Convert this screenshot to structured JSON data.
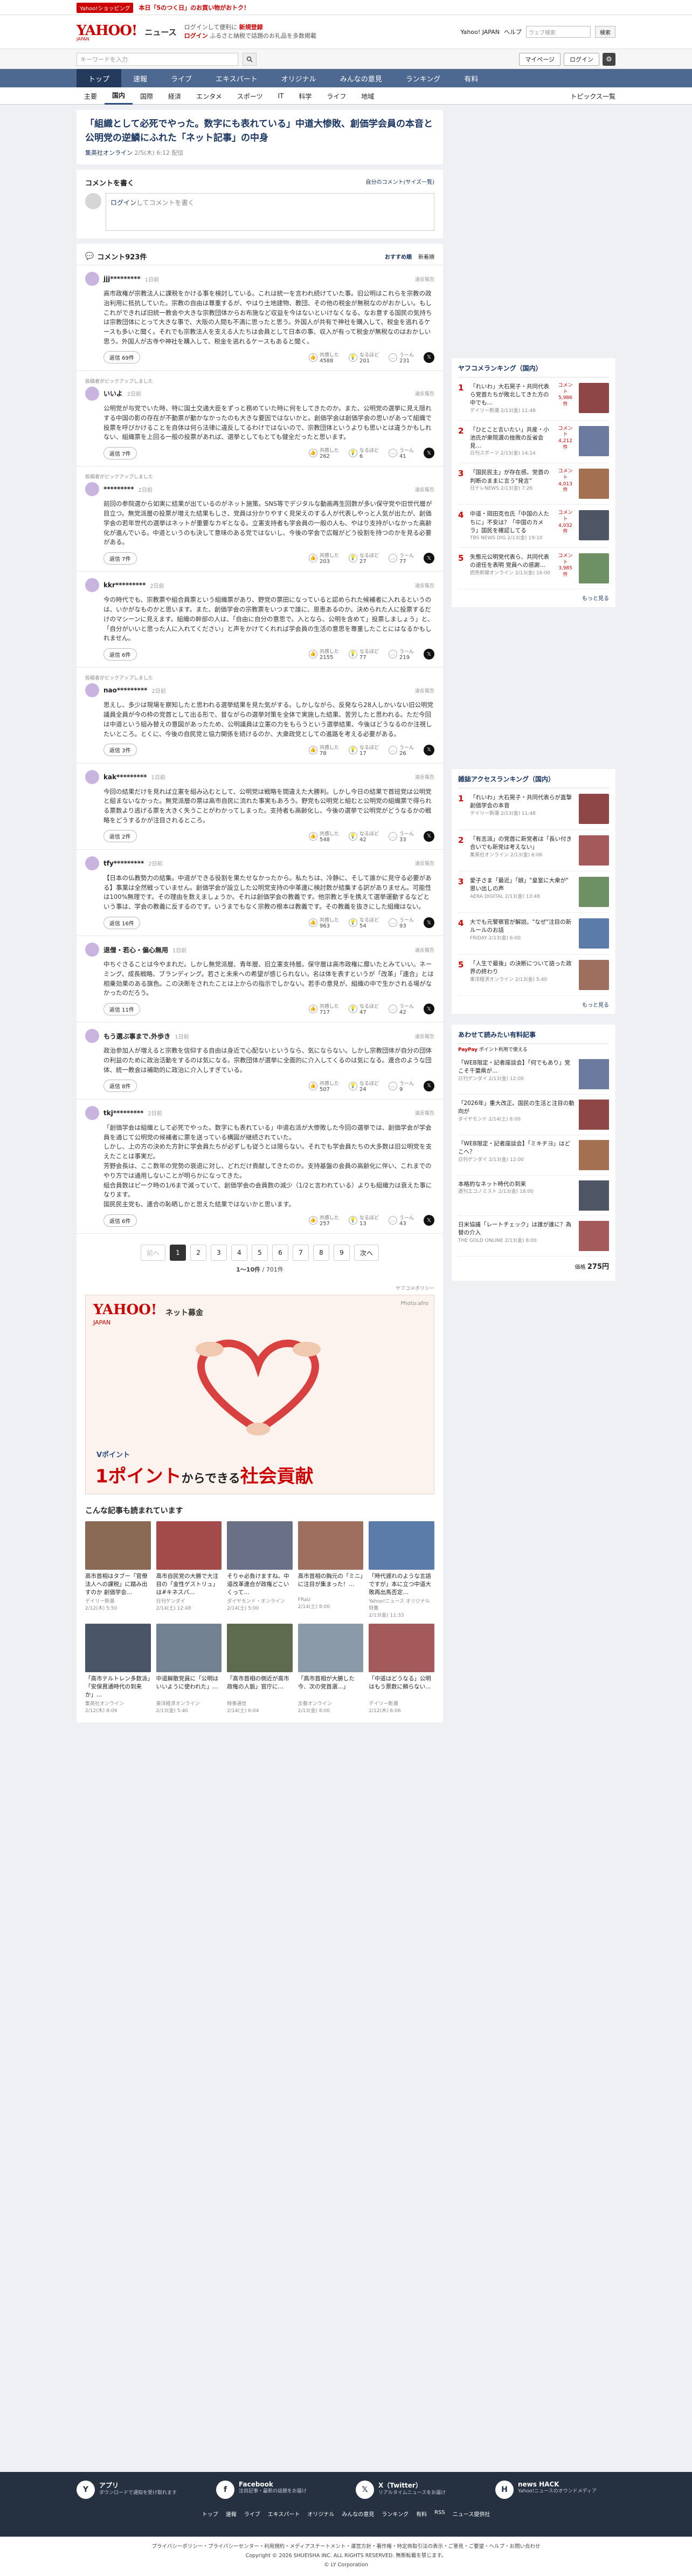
{
  "topline": {
    "promo": "Yahoo!ショッピング",
    "promo_text": "本日「5のつく日」のお買い物がおトク！"
  },
  "header": {
    "logo": "YAHOO!",
    "logo_sub": "JAPAN",
    "service": "ニュース",
    "l1a": "ログインして便利に",
    "l1b": "新規登録",
    "l2a": "ログイン",
    "l2b": "ふるさと納税で話題のお礼品を多数掲載",
    "yj": "Yahoo! JAPAN",
    "help": "ヘルプ",
    "search_ph": "ウェブ検索",
    "search_btn": "検索"
  },
  "searchbar": {
    "placeholder": "キーワードを入力",
    "mypage": "マイページ",
    "login": "ログイン",
    "gear": "⚙"
  },
  "gnav": [
    "トップ",
    "速報",
    "ライブ",
    "エキスパート",
    "オリジナル",
    "みんなの意見",
    "ランキング",
    "有料"
  ],
  "snav": [
    "主要",
    "国内",
    "国際",
    "経済",
    "エンタメ",
    "スポーツ",
    "IT",
    "科学",
    "ライフ",
    "地域"
  ],
  "snav_right": "トピックス一覧",
  "article": {
    "title": "「組織として必死でやった。数字にも表れている」中道大惨敗、創価学会員の本音と公明党の逆鱗にふれた「ネット記事」の中身",
    "source": "集英社オンライン",
    "date": "2/5(木) 6:12 配信"
  },
  "comment_box": {
    "title": "コメントを書く",
    "rule": "自分のコメント(サイズ一覧)",
    "login": "ログイン",
    "text": "してコメントを書く"
  },
  "clist": {
    "title": "コメント923件",
    "sort1": "おすすめ順",
    "sort2": "新着順"
  },
  "labels": {
    "reply": "返信",
    "agree": "共感した",
    "insight": "なるほど",
    "hmm": "うーん",
    "report": "違反報告",
    "x": "𝕏",
    "pick": "投稿者がピックアップしました"
  },
  "comments": [
    {
      "name": "jjj*********",
      "time": "1日前",
      "pick": "",
      "body": "高市政権が宗教法人に課税をかける事を検討している。これは統一を言われ続けていた事。旧公明はこれらを宗教の政治利用に抵抗していた。宗教の自由は尊重するが、やはり土地建物、教団、その他の税金が無税なのがおかしい。もしこれができれば旧統一教会や大きな宗教団体からお布施など収益を今はないといけなくなる。なお意する国民の気持ちは宗教団体にとって大きな事で、大阪の人間も不満に思ったと思う。外国人が共有で神社を購入して、税金を逃れるケースも多いと聞く。それでも宗教法人を支える人たちは会員として日本の事、収入が有って税金が無税なのはおかしい思う。外国人が古寺や神社を購入して、税金を逃れるケースもあると聞く。",
      "reply": "返信 69件",
      "agree": "4588",
      "insight": "201",
      "hmm": "231"
    },
    {
      "name": "いいよ",
      "time": "2日前",
      "pick": "投稿者がピックアップしました",
      "body": "公明党が与党でいた時、特に国土交通大臣をずっと務めていた時に何をしてきたのか。また、公明党の選挙に見え隠れする中国の影の存在が不動票が動かなかったのも大きな要因ではないかと。創価学会は創価学会の思いがあって組織で投票を呼びかけることを自体は何ら法律に違反してるわけではないので、宗教団体というよりも思いとは違うかもしれない、組織票を上回る一般の投票があれば、選挙としてもとても健全だったと思います。",
      "reply": "返信 7件",
      "agree": "262",
      "insight": "6",
      "hmm": "41"
    },
    {
      "name": "*********",
      "time": "2日前",
      "pick": "投稿者がピックアップしました",
      "body": "前回の参院選から如実に結果が出ているのがネット施策。SNS等でデジタルな動画再生回数が多い保守党や旧世代層が目立つ。無党派層の投票が増えた結果もしさ、党員は分かりやすく見栄えのする人が代表しやっと人気が出たが、創価学会の若年世代の選挙はネットが重要なカギとなる。立憲支持者も学会員の一般の人も、やはり支持がいなかった高齢化が進んでいる。中道というのも決して意味のある党ではないし、今後の学会で広報がどう役割を持つのかを見る必要がある。",
      "reply": "返信 7件",
      "agree": "203",
      "insight": "27",
      "hmm": "77"
    },
    {
      "name": "kkr*********",
      "time": "2日前",
      "pick": "",
      "body": "今の時代でも、宗教票や組合員票という組織票があり、野党の票田になっていると認められた候補者に入れるというのは、いかがなものかと思います。また、創価学会の宗教票をいつまで誰に、恩恵あるのか。決められた人に投票するだけのマシーンに見えます。組織の幹部の人は、「自由に自分の意思で。入となら、公明を含めて」投票しましょう」と、「自分がいいと思った人に入れてください」と声をかけてくれれば学会員の生活の意思を尊重したことにはなるかもしれません。",
      "reply": "返信 6件",
      "agree": "2155",
      "insight": "77",
      "hmm": "219"
    },
    {
      "name": "nao*********",
      "time": "2日前",
      "pick": "投稿者がピックアップしました",
      "body": "思えし、多少は現場を察知したと思われる選挙結果を見た気がする。しかしながら、反発なら28人しかいない旧公明党議員全員が今の枠の党首として出る形で、昔ながらの選挙対策を全体で実施した結果、苦労したと思われる。ただ今回は中道という組み替えの意図があったため、公明議員は立憲の力をもらうという選挙結果、今後はどうなるのか注視したいところ。とくに、今後の自民党と協力関係を続けるのか、大衆政党としての進路を考える必要がある。",
      "reply": "返信 3件",
      "agree": "78",
      "insight": "17",
      "hmm": "26"
    },
    {
      "name": "kak*********",
      "time": "1日前",
      "pick": "",
      "body": "今回の結果だけを見れば立憲を組み込むとして、公明党は戦略を間違えた大勝利。しかし今日の結果で首班党は公明党と組まないなかった。無党派層の票は高市自民に流れた事実もあろう。野党も公明党と組むと公明党の組織票で得られる票数より逃げる票を大きく失うことがわかってしまった。支持者も高齢化し、今後の選挙で公明党がどうなるかの戦略をどうするかが注目されるところ。",
      "reply": "返信 2件",
      "agree": "548",
      "insight": "42",
      "hmm": "33"
    },
    {
      "name": "tfy*********",
      "time": "2日前",
      "pick": "",
      "body": "【日本の仏教勢力の結集。中道ができる役割を果たせなかったから。私たちは、冷静に、そして誰かに見守る必要がある】事業は全然戦っていません。創価学会が設立した公明党支持の中革連に検討数が結集する訳がありません。可能性は100%無理です。その理由を数えましょうか。それは創価学会の教義です。他宗教と手を携えて選挙運動するなどという事は、学会の教義に反するのです。いうまでもなく宗教の根本は教義です。その教義を抜きにした組織はない。",
      "reply": "返信 16件",
      "agree": "963",
      "insight": "54",
      "hmm": "93"
    },
    {
      "name": "退僧・若心・偏心無用",
      "time": "1日前",
      "pick": "",
      "body": "中ちぐさることは今やまれだ。しかし無党派層、青年層、旧立憲支持層。保守層は高市政権に靡いたとみていい。ネーミング、成長戦略、ブランディング。若さと未来への希望が感じられない。名は体を表すというが「改革」「連合」とは相乗効果のある旗色。この決断をされたことは上からの指示でしかない。若手の意見が、組織の中で生かされる場がなかったのだろう。",
      "reply": "返信 11件",
      "agree": "717",
      "insight": "47",
      "hmm": "42"
    },
    {
      "name": "もう選ぶ事まで.外歩き",
      "time": "1日前",
      "pick": "",
      "body": "政治参加人が増えると宗教を信仰する自由は身近で心配ないというなら、気にならない。しかし宗教団体が自分の団体の利益のために政治活動をするのは気になる。宗教団体が選挙に全面的に介入してくるのは気になる。連合のような団体、統一教会は補助的に政治に介入しすぎている。",
      "reply": "返信 8件",
      "agree": "507",
      "insight": "24",
      "hmm": "9"
    },
    {
      "name": "tkj*********",
      "time": "2日前",
      "pick": "",
      "body": "「創価学会は組織として必死でやった。数字にも表れている」中道右派が大惨敗した今回の選挙では、創価学会が学会員を通じて公明党の候補者に票を送っている構図が継続されていた。\nしかし、上の方の決めた方針に学会員たちが必ずしも従うとは限らない。それでも学会員たちの大多数は旧公明党を支えたことは事実だ。\n芳野会長は、ここ数年の党勢の衰退に対し、どれだけ貢献してきたのか。支持基盤の会員の高齢化に伴い、これまでのやり方では通用しないことが明らかになってきた。\n組合員数はピーク時の1/6まで減っていて、創価学会の会員数の減少（1/2と言われている）よりも組織力は衰えた事になります。\n国民民主党も、連合の恥晒しかと思えた結果ではないかと思います。",
      "reply": "返信 6件",
      "agree": "257",
      "insight": "13",
      "hmm": "43"
    }
  ],
  "pager": {
    "prev": "前へ",
    "next": "次へ",
    "pages": [
      "1",
      "2",
      "3",
      "4",
      "5",
      "6",
      "7",
      "8",
      "9"
    ],
    "info_a": "1〜10件",
    "info_b": "/ 701件"
  },
  "adnote": "ヤフコメポリシー",
  "banner": {
    "logo": "YAHOO!",
    "logo_sub": "JAPAN",
    "title": "ネット募金",
    "credit": "Photo:afro",
    "line1": "Vポイント",
    "line2a": "1ポイント",
    "line2b": "からできる",
    "line2c": "社会貢献"
  },
  "recs": {
    "title": "こんな記事も読まれています",
    "items": [
      {
        "title": "高市首相はタブー「官僚法人への課税」に踏み出すのか 創価学会…",
        "src": "デイリー新潮",
        "date": "2/12(木) 5:50",
        "color": "#8b6a55"
      },
      {
        "title": "高市自民党の大勝で大注目の「金性ゲストリュ」は#キネスパ…",
        "src": "日刊ゲンダイ",
        "date": "2/14(土) 12:48",
        "color": "#a34b4b"
      },
      {
        "title": "そりゃ必負けますね。中道改革連合が政権どこいくって…",
        "src": "ダイヤモンド・オンライン",
        "date": "2/14(土) 5:00",
        "color": "#6a7085"
      },
      {
        "title": "高市首相の胸元の「ミニ」に注目が集まった！…",
        "src": "FRaU",
        "date": "2/14(土) 8:00",
        "color": "#9e6f5e"
      },
      {
        "title": "「時代遅れのような言語ですが」本に立つ中道大敗再出馬否定…",
        "src": "Yahoo!ニュース オリジナル 特集",
        "date": "2/13(金) 11:33",
        "color": "#5b7ca8"
      },
      {
        "title": "「高市テルトレン多数派」「安保貫通時代の到来か」…",
        "src": "集英社オンライン",
        "date": "2/12(木) 8:09",
        "color": "#4b5568"
      },
      {
        "title": "中道解散党員に「公明はいいように使われた」…",
        "src": "東洋経済オンライン",
        "date": "2/13(金) 5:40",
        "color": "#728293"
      },
      {
        "title": "「高市首相の側近が高市政権の人脈」官庁に…",
        "src": "時事通信",
        "date": "2/14(土) 6:04",
        "color": "#5e6b4e"
      },
      {
        "title": "「高市首相が大勝した今、次の党首選…」",
        "src": "文春オンライン",
        "date": "2/13(金) 8:00",
        "color": "#8a9aa8"
      },
      {
        "title": "「中道はどうなる」公明はもう票数に頼らない…",
        "src": "デイリー新潮",
        "date": "2/12(木) 6:06",
        "color": "#a45a5a"
      }
    ]
  },
  "ranking": {
    "title": "ヤフコメランキング（国内）",
    "items": [
      {
        "no": "1",
        "title": "「れいわ」大石晃子・共同代表ら党首たちが敗北してきた方の中でも…",
        "date": "デイリー新潮 2/13(金) 11:48",
        "cnt": "コメント 5,986件",
        "color": "#8f4646"
      },
      {
        "title": "「ひとこと言いたい」共産・小池氏が衆院選の挫敗の反省会見…",
        "no": "2",
        "date": "日刊スポーツ 2/13(金) 14:14",
        "cnt": "コメント 4,212件",
        "color": "#6d7aa0"
      },
      {
        "no": "3",
        "title": "「国民民主」が存在感。党首の判断のままに言う\"発言\"",
        "date": "日テレNEWS 2/13(金) 7:26",
        "cnt": "コメント 4,013件",
        "color": "#a47052"
      },
      {
        "no": "4",
        "title": "中道・岡田克也氏「中国の人たちに」不安は？「中国のカメラ」国民を確認してる",
        "date": "TBS NEWS DIG 2/13(金) 19:10",
        "cnt": "コメント 4,032件",
        "color": "#4e5565"
      },
      {
        "no": "5",
        "title": "失態元公明党代表ら、共同代表の退任を表明 党員への感謝…",
        "date": "読売新聞オンライン 2/13(金) 16:00",
        "cnt": "コメント 3,985件",
        "color": "#6f8f64"
      }
    ],
    "more": "もっと見る"
  },
  "access": {
    "title": "雑誌アクセスランキング（国内）",
    "items": [
      {
        "no": "1",
        "title": "「れいわ」大石晃子・共同代表らが直撃 創価学会の本音",
        "date": "デイリー新潮 2/13(金) 11:48",
        "cnt": "",
        "color": "#8f4646"
      },
      {
        "no": "2",
        "title": "「有志派」の党首に新党者は「長い付き合いでも新党は考えない」",
        "date": "集英社オンライン 2/13(金) 6:06",
        "cnt": "",
        "color": "#a45a5a"
      },
      {
        "no": "3",
        "title": "愛子さま「最近」「娘」\"皇室に大衆が\" 思い出しの声",
        "date": "AERA DIGITAL 2/13(金) 13:48",
        "cnt": "",
        "color": "#6f8f64"
      },
      {
        "no": "4",
        "title": "大でも元警察官が解説。\"なぜ\"注目の新ルールのお話",
        "date": "FRIDAY 2/13(金) 6:00",
        "cnt": "",
        "color": "#5b7ca8"
      },
      {
        "no": "5",
        "title": "「人生で最後」の決断について語った政界の終わり",
        "date": "東洋経済オンライン 2/13(金) 5:40",
        "cnt": "",
        "color": "#9e6f5e"
      }
    ],
    "more": "もっと見る"
  },
  "ecom": {
    "title": "あわせて読みたい有料記事",
    "paypay": "PayPay",
    "paypay_txt": "ポイント利用で使える",
    "items": [
      {
        "title": "「WEB限定・記者座談会】「何でもあり」党こそ千葉県が…",
        "date": "日刊ゲンダイ 2/13(金) 12:00",
        "color": "#6d7aa0"
      },
      {
        "title": "「2026年」重大改正。国民の生活と注目の動向が",
        "date": "ダイヤモンド 2/14(土) 8:00",
        "color": "#8f4646"
      },
      {
        "title": "「WEB限定・記者座談会】「ミキチヨ」はどこへ？",
        "date": "日刊ゲンダイ 2/13(金) 12:00",
        "color": "#a47052"
      },
      {
        "title": "本格的なネット時代の到来",
        "date": "週刊エコノミスト 2/13(金) 18:00",
        "color": "#4e5565"
      },
      {
        "title": "日米協議「レートチェック」は誰が誰に？為替の介入",
        "date": "THE GOLD ONLINE 2/13(金) 8:00",
        "color": "#a45a5a"
      }
    ],
    "price_a": "価格",
    "price_b": "275円"
  },
  "footer": {
    "b1t": "アプリ",
    "b1s": "ダウンロードで通知を受け取れます",
    "b2t": "Facebook",
    "b2s": "注目記事・最新の話題をお届け",
    "b3t": "X（Twitter）",
    "b3s": "リアルタイムニュースをお届け",
    "b4t": "news HACK",
    "b4s": "Yahoo!ニュースのオウンドメディア",
    "links": [
      "トップ",
      "速報",
      "ライブ",
      "エキスパート",
      "オリジナル",
      "みんなの意見",
      "ランキング",
      "有料",
      "RSS",
      "ニュース提供社"
    ],
    "policy": "プライバシーポリシー・プライバシーセンター・利用規約・メディアステートメント・運営方針・著作権・特定商取引法の表示・ご意見・ご要望・ヘルプ・お問い合わせ",
    "copy": "Copyright © 2026 SHUEISHA INC. ALL RIGHTS RESERVED. 無断転載を禁じます。",
    "corp": "© LY Corporation"
  }
}
